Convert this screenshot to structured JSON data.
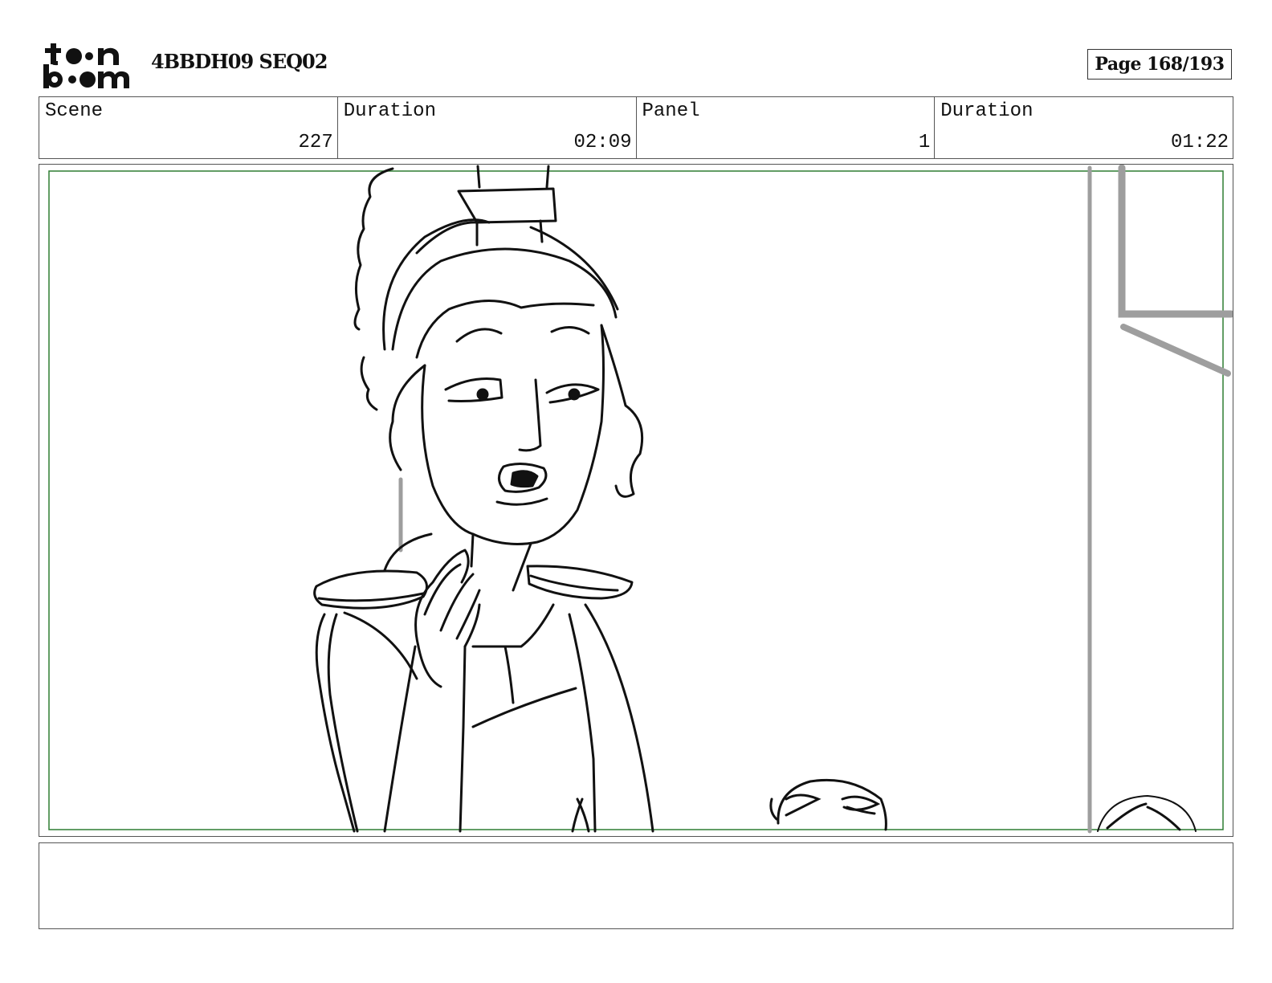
{
  "header": {
    "logo_text": "toon boom",
    "project": "4BBDH09 SEQ02",
    "page": "Page 168/193"
  },
  "info": {
    "scene_label": "Scene",
    "scene_value": "227",
    "scene_duration_label": "Duration",
    "scene_duration_value": "02:09",
    "panel_label": "Panel",
    "panel_value": "1",
    "panel_duration_label": "Duration",
    "panel_duration_value": "01:22"
  },
  "panel": {
    "safe_frame_color": "#2e7d32",
    "line_color": "#111111",
    "bg_line_color": "#9e9e9e"
  },
  "notes": {
    "text": ""
  }
}
